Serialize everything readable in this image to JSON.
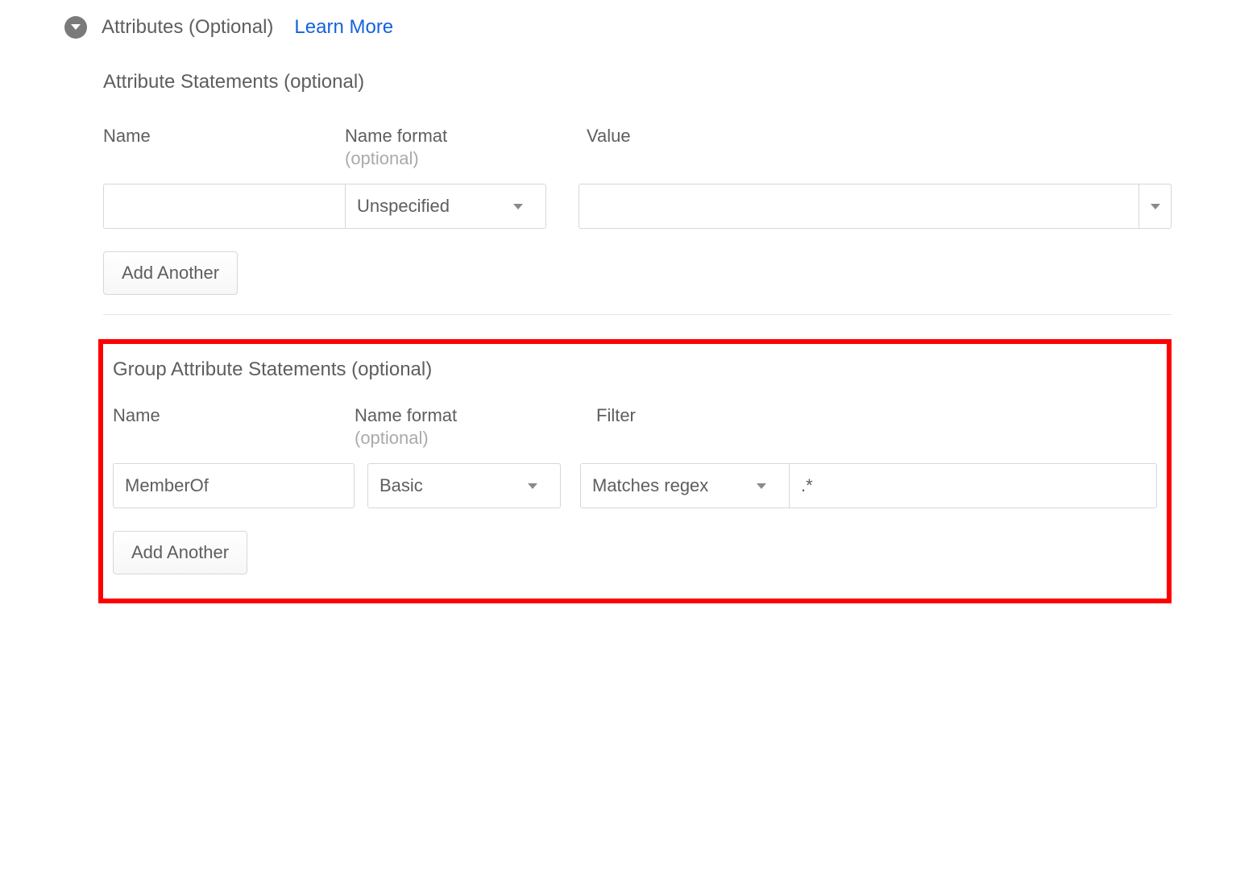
{
  "header": {
    "section_title": "Attributes (Optional)",
    "learn_more": "Learn More"
  },
  "attribute_statements": {
    "title": "Attribute Statements (optional)",
    "columns": {
      "name": "Name",
      "name_format": "Name format",
      "name_format_sub": "(optional)",
      "value": "Value"
    },
    "row": {
      "name_value": "",
      "format_selected": "Unspecified",
      "value_selected": ""
    },
    "add_another": "Add Another"
  },
  "group_attribute_statements": {
    "title": "Group Attribute Statements (optional)",
    "columns": {
      "name": "Name",
      "name_format": "Name format",
      "name_format_sub": "(optional)",
      "filter": "Filter"
    },
    "row": {
      "name_value": "MemberOf",
      "format_selected": "Basic",
      "filter_type_selected": "Matches regex",
      "filter_value": ".*"
    },
    "add_another": "Add Another"
  }
}
